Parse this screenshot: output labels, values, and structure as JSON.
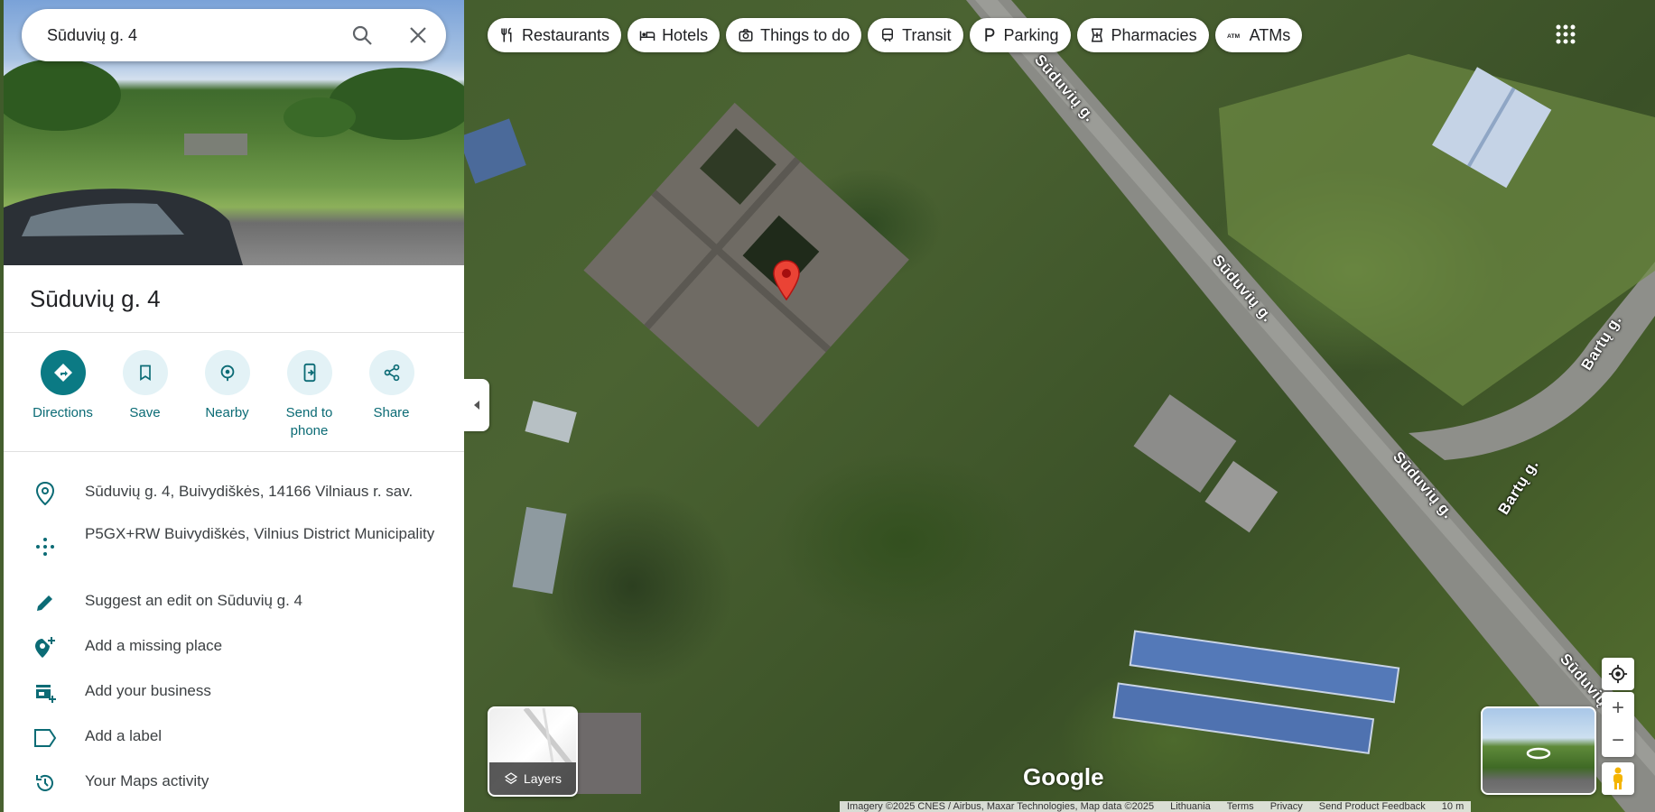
{
  "search": {
    "value": "Sūduvių g. 4"
  },
  "place": {
    "title": "Sūduvių g. 4"
  },
  "actions": [
    {
      "label": "Directions",
      "icon": "directions-icon"
    },
    {
      "label": "Save",
      "icon": "bookmark-icon"
    },
    {
      "label": "Nearby",
      "icon": "nearby-icon"
    },
    {
      "label": "Send to phone",
      "icon": "send-to-phone-icon"
    },
    {
      "label": "Share",
      "icon": "share-icon"
    }
  ],
  "info": {
    "address": "Sūduvių g. 4, Buivydiškės, 14166 Vilniaus r. sav.",
    "plus_code": "P5GX+RW Buivydiškės, Vilnius District Municipality",
    "suggest_edit": "Suggest an edit on Sūduvių g. 4",
    "add_missing_place": "Add a missing place",
    "add_business": "Add your business",
    "add_label": "Add a label",
    "maps_activity": "Your Maps activity"
  },
  "chips": [
    {
      "label": "Restaurants",
      "icon": "restaurant-icon"
    },
    {
      "label": "Hotels",
      "icon": "hotel-icon"
    },
    {
      "label": "Things to do",
      "icon": "camera-icon"
    },
    {
      "label": "Transit",
      "icon": "transit-icon"
    },
    {
      "label": "Parking",
      "icon": "parking-icon"
    },
    {
      "label": "Pharmacies",
      "icon": "pharmacy-icon"
    },
    {
      "label": "ATMs",
      "icon": "atm-icon"
    }
  ],
  "map": {
    "road_labels": [
      "Sūduvių g.",
      "Sūduvių g.",
      "Sūduvių g.",
      "Sūduvių g.",
      "Bartų g.",
      "Bartų g."
    ],
    "layers_label": "Layers",
    "logo": "Google",
    "footer": {
      "imagery": "Imagery ©2025 CNES / Airbus, Maxar Technologies, Map data ©2025",
      "country": "Lithuania",
      "terms": "Terms",
      "privacy": "Privacy",
      "feedback": "Send Product Feedback",
      "scale": "10 m"
    }
  },
  "colors": {
    "accent": "#0b7a84",
    "pin": "#ea4335"
  }
}
